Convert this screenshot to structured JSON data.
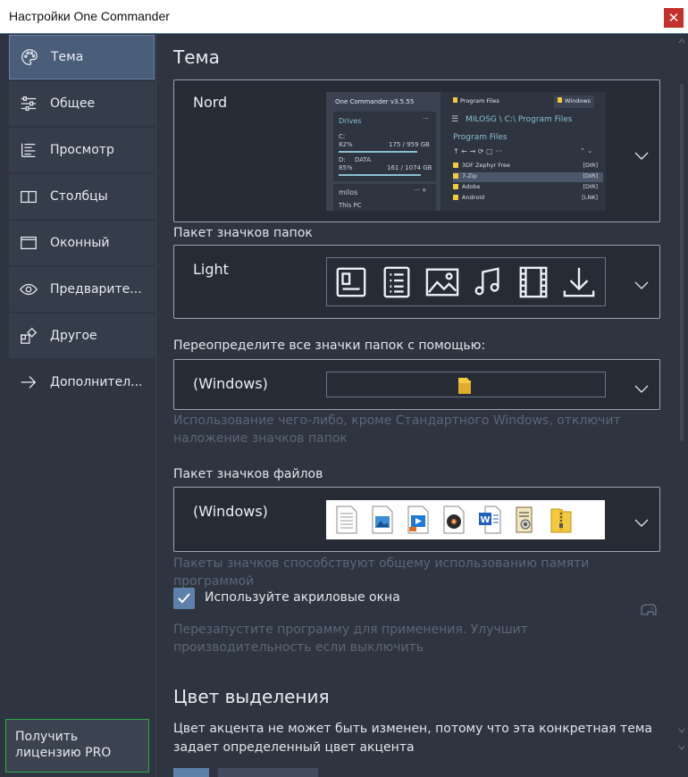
{
  "window": {
    "title": "Настройки One Commander",
    "close_glyph": "✕"
  },
  "sidebar": {
    "items": [
      {
        "label": "Тема",
        "icon": "palette-icon",
        "active": true
      },
      {
        "label": "Общее",
        "icon": "sliders-icon",
        "active": false
      },
      {
        "label": "Просмотр",
        "icon": "list-view-icon",
        "active": false
      },
      {
        "label": "Столбцы",
        "icon": "columns-icon",
        "active": false
      },
      {
        "label": "Оконный",
        "icon": "window-icon",
        "active": false
      },
      {
        "label": "Предварите...",
        "icon": "eye-icon",
        "active": false
      },
      {
        "label": "Другое",
        "icon": "shapes-icon",
        "active": false
      },
      {
        "label": "Дополнител...",
        "icon": "arrow-right-icon",
        "active": false
      }
    ],
    "license_button": "Получить лицензию PRO"
  },
  "content": {
    "theme_title": "Тема",
    "theme_value": "Nord",
    "theme_preview": {
      "app_title": "One Commander v3.5.55",
      "tab1": "Program Files",
      "tab2": "Windows",
      "drives_label": "Drives",
      "drive_c": "C:",
      "drive_c_pct": "82%",
      "drive_c_size": "175 / 959 GB",
      "drive_d": "D:",
      "drive_d_name": "DATA",
      "drive_d_pct": "85%",
      "drive_d_size": "161 / 1074 GB",
      "path": "MILOSG \\ C:\\ Program Files",
      "folder_heading": "Program Files",
      "milos_label": "milos",
      "this_pc": "This PC",
      "rows": [
        {
          "name": "3DF Zephyr Free",
          "type": "[DIR]"
        },
        {
          "name": "7-Zip",
          "type": "[DIR]"
        },
        {
          "name": "Adobe",
          "type": "[DIR]"
        },
        {
          "name": "Android",
          "type": "[LNK]"
        }
      ]
    },
    "folder_pack_label": "Пакет значков папок",
    "folder_pack_value": "Light",
    "override_label": "Переопределите все значки папок с помощью:",
    "override_value": "(Windows)",
    "override_hint": "Использование чего-либо, кроме Стандартного Windows, отключит наложение значков папок",
    "file_pack_label": "Пакет значков файлов",
    "file_pack_value": "(Windows)",
    "file_pack_hint": "Пакеты значков способствуют общему использованию памяти программой",
    "acrylic_label": "Используйте акриловые окна",
    "acrylic_checked": true,
    "acrylic_hint": "Перезапустите программу для применения. Улучшит производительность если выключить",
    "accent_title": "Цвет выделения",
    "accent_hint": "Цвет акцента не может быть изменен, потому что эта конкретная тема задает определенный цвет акцента"
  }
}
